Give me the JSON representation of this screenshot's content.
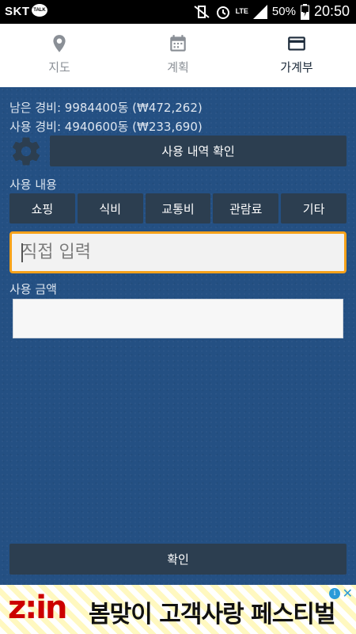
{
  "status": {
    "carrier": "SKT",
    "talk_badge": "TALK",
    "network": "LTE",
    "battery": "50%",
    "time": "20:50"
  },
  "tabs": [
    {
      "label": "지도",
      "icon": "map-pin-icon",
      "active": false
    },
    {
      "label": "계획",
      "icon": "calendar-icon",
      "active": false
    },
    {
      "label": "가계부",
      "icon": "card-icon",
      "active": true
    }
  ],
  "budget": {
    "remaining": "남은 경비: 9984400동 (₩472,262)",
    "used": "사용 경비: 4940600동 (₩233,690)"
  },
  "history_button": "사용 내역 확인",
  "usage_label": "사용 내용",
  "categories": [
    "쇼핑",
    "식비",
    "교통비",
    "관람료",
    "기타"
  ],
  "direct_input_placeholder": "직접 입력",
  "amount_label": "사용 금액",
  "amount_value": "",
  "confirm_button": "확인",
  "ad": {
    "brand": "z:in",
    "headline": "봄맞이 고객사랑 페스티벌",
    "colors": {
      "brand": "#cc0000",
      "info": "#2a9bd8"
    }
  },
  "colors": {
    "background": "#245083",
    "button": "#2c3e50",
    "focus_border": "#f7a21b",
    "tab_active": "#1c2a3a",
    "tab_inactive": "#8a8f96"
  }
}
